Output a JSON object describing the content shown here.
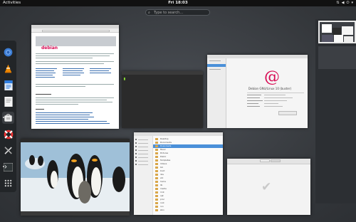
{
  "topbar": {
    "activities": "Activities",
    "clock": "Fri 18:03",
    "icons": [
      "network-icon",
      "volume-icon",
      "power-icon",
      "chevron-down-icon"
    ]
  },
  "search": {
    "placeholder": "Type to search…"
  },
  "dash": {
    "apps": [
      {
        "name": "Chromium"
      },
      {
        "name": "VLC media player"
      },
      {
        "name": "LibreOffice Writer"
      },
      {
        "name": "Text Editor"
      },
      {
        "name": "Software"
      },
      {
        "name": "Help"
      },
      {
        "name": "Settings"
      },
      {
        "name": "Terminal"
      },
      {
        "name": "Show Applications"
      }
    ]
  },
  "windows": {
    "firefox": {
      "page_heading": "debian"
    },
    "about": {
      "os_name": "Debian GNU/Linux 10 (buster)"
    },
    "files": {
      "rows": [
        {
          "name": "Desktop",
          "size": ""
        },
        {
          "name": "Documents",
          "size": ""
        },
        {
          "name": "Downloads",
          "size": ""
        },
        {
          "name": "Music",
          "size": ""
        },
        {
          "name": "Pictures",
          "size": ""
        },
        {
          "name": "Public",
          "size": ""
        },
        {
          "name": "Templates",
          "size": ""
        },
        {
          "name": "Videos",
          "size": ""
        },
        {
          "name": "bin",
          "size": ""
        },
        {
          "name": "boot",
          "size": ""
        },
        {
          "name": "dev",
          "size": ""
        },
        {
          "name": "etc",
          "size": ""
        },
        {
          "name": "home",
          "size": ""
        },
        {
          "name": "lib",
          "size": ""
        },
        {
          "name": "media",
          "size": ""
        },
        {
          "name": "mnt",
          "size": ""
        },
        {
          "name": "opt",
          "size": ""
        },
        {
          "name": "proc",
          "size": ""
        },
        {
          "name": "root",
          "size": ""
        },
        {
          "name": "run",
          "size": ""
        },
        {
          "name": "sbin",
          "size": ""
        }
      ]
    }
  },
  "colors": {
    "topbar": "#111111",
    "debian_red": "#d70a53",
    "selection_blue": "#4a90d9"
  }
}
